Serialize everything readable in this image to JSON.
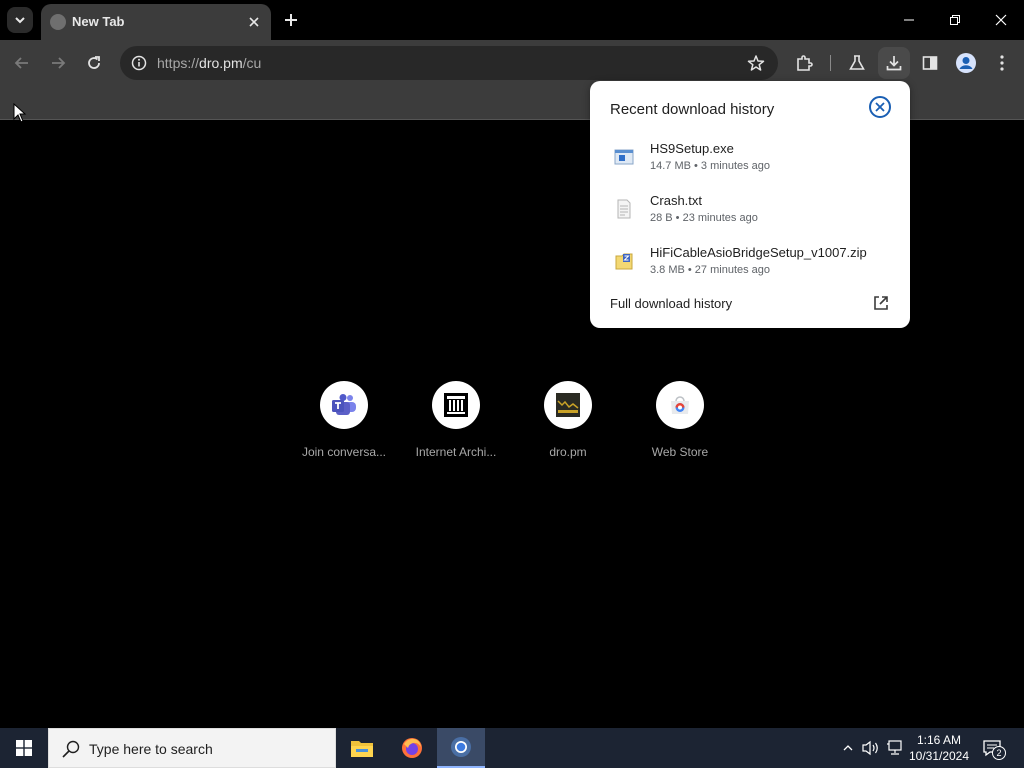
{
  "browser": {
    "tab": {
      "title": "New Tab"
    },
    "address": {
      "scheme": "https://",
      "host": "dro.pm",
      "path": "/cu"
    }
  },
  "downloads_bubble": {
    "title": "Recent download history",
    "items": [
      {
        "name": "HS9Setup.exe",
        "meta": "14.7 MB • 3 minutes ago",
        "icon": "exe-file-icon"
      },
      {
        "name": "Crash.txt",
        "meta": "28 B • 23 minutes ago",
        "icon": "text-file-icon"
      },
      {
        "name": "HiFiCableAsioBridgeSetup_v1007.zip",
        "meta": "3.8 MB • 27 minutes ago",
        "icon": "zip-file-icon"
      }
    ],
    "full_history_label": "Full download history"
  },
  "shortcuts": [
    {
      "label": "Join conversa...",
      "icon": "teams-icon"
    },
    {
      "label": "Internet Archi...",
      "icon": "archive-icon"
    },
    {
      "label": "dro.pm",
      "icon": "dropm-icon"
    },
    {
      "label": "Web Store",
      "icon": "webstore-icon"
    }
  ],
  "taskbar": {
    "search_placeholder": "Type here to search",
    "time": "1:16 AM",
    "date": "10/31/2024",
    "notification_count": "2"
  },
  "colors": {
    "accent": "#1a5fb4",
    "toolbar": "#3c3c3c",
    "taskbar": "#1c2433"
  }
}
